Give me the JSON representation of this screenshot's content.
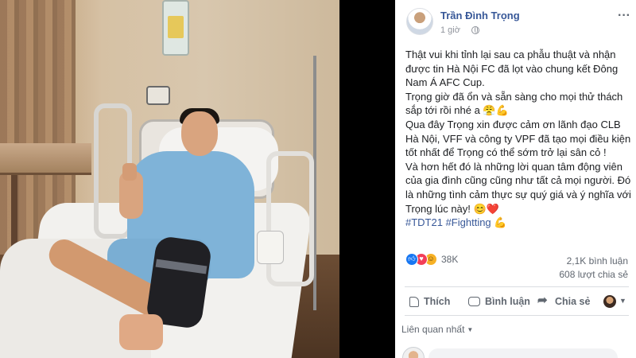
{
  "post": {
    "author": "Trần Đình Trọng",
    "time": "1 giờ",
    "body": [
      "Thật vui khi tỉnh lại sau ca phẫu thuật và nhận được tin Hà Nội FC đã lọt vào chung kết Đông Nam Á AFC Cup.",
      "Trọng giờ đã ổn và sẵn sàng cho mọi thử thách sắp tới rồi nhé a 😤💪",
      "Qua đây Trọng xin được cảm ơn lãnh đạo CLB Hà Nội, VFF và công ty VPF đã tạo mọi điều kiện tốt nhất để Trọng có thể sớm trở lại sân cỏ !",
      "Và hơn hết đó là những lời quan tâm động viên của gia đình cũng cũng như tất cả mọi người. Đó là những tình cảm thực sự quý giá và ý nghĩa với Trọng lúc này! 😊❤️"
    ],
    "tags": "#TDT21 #Fightting 💪"
  },
  "stats": {
    "reactions": "38K",
    "comments": "2,1K bình luận",
    "shares": "608 lượt chia sẻ"
  },
  "actions": {
    "like": "Thích",
    "comment": "Bình luận",
    "share": "Chia sẻ"
  },
  "comments": {
    "sort_label": "Liên quan nhất"
  },
  "icons": {
    "like": "like-reaction-icon",
    "love": "love-reaction-icon",
    "haha": "haha-reaction-icon",
    "privacy": "globe-icon",
    "more": "more-options-icon"
  },
  "colors": {
    "link": "#385898",
    "text": "#1c1e21",
    "muted": "#606770",
    "like": "#1877f2",
    "love": "#f33e58",
    "haha": "#f7b125"
  }
}
